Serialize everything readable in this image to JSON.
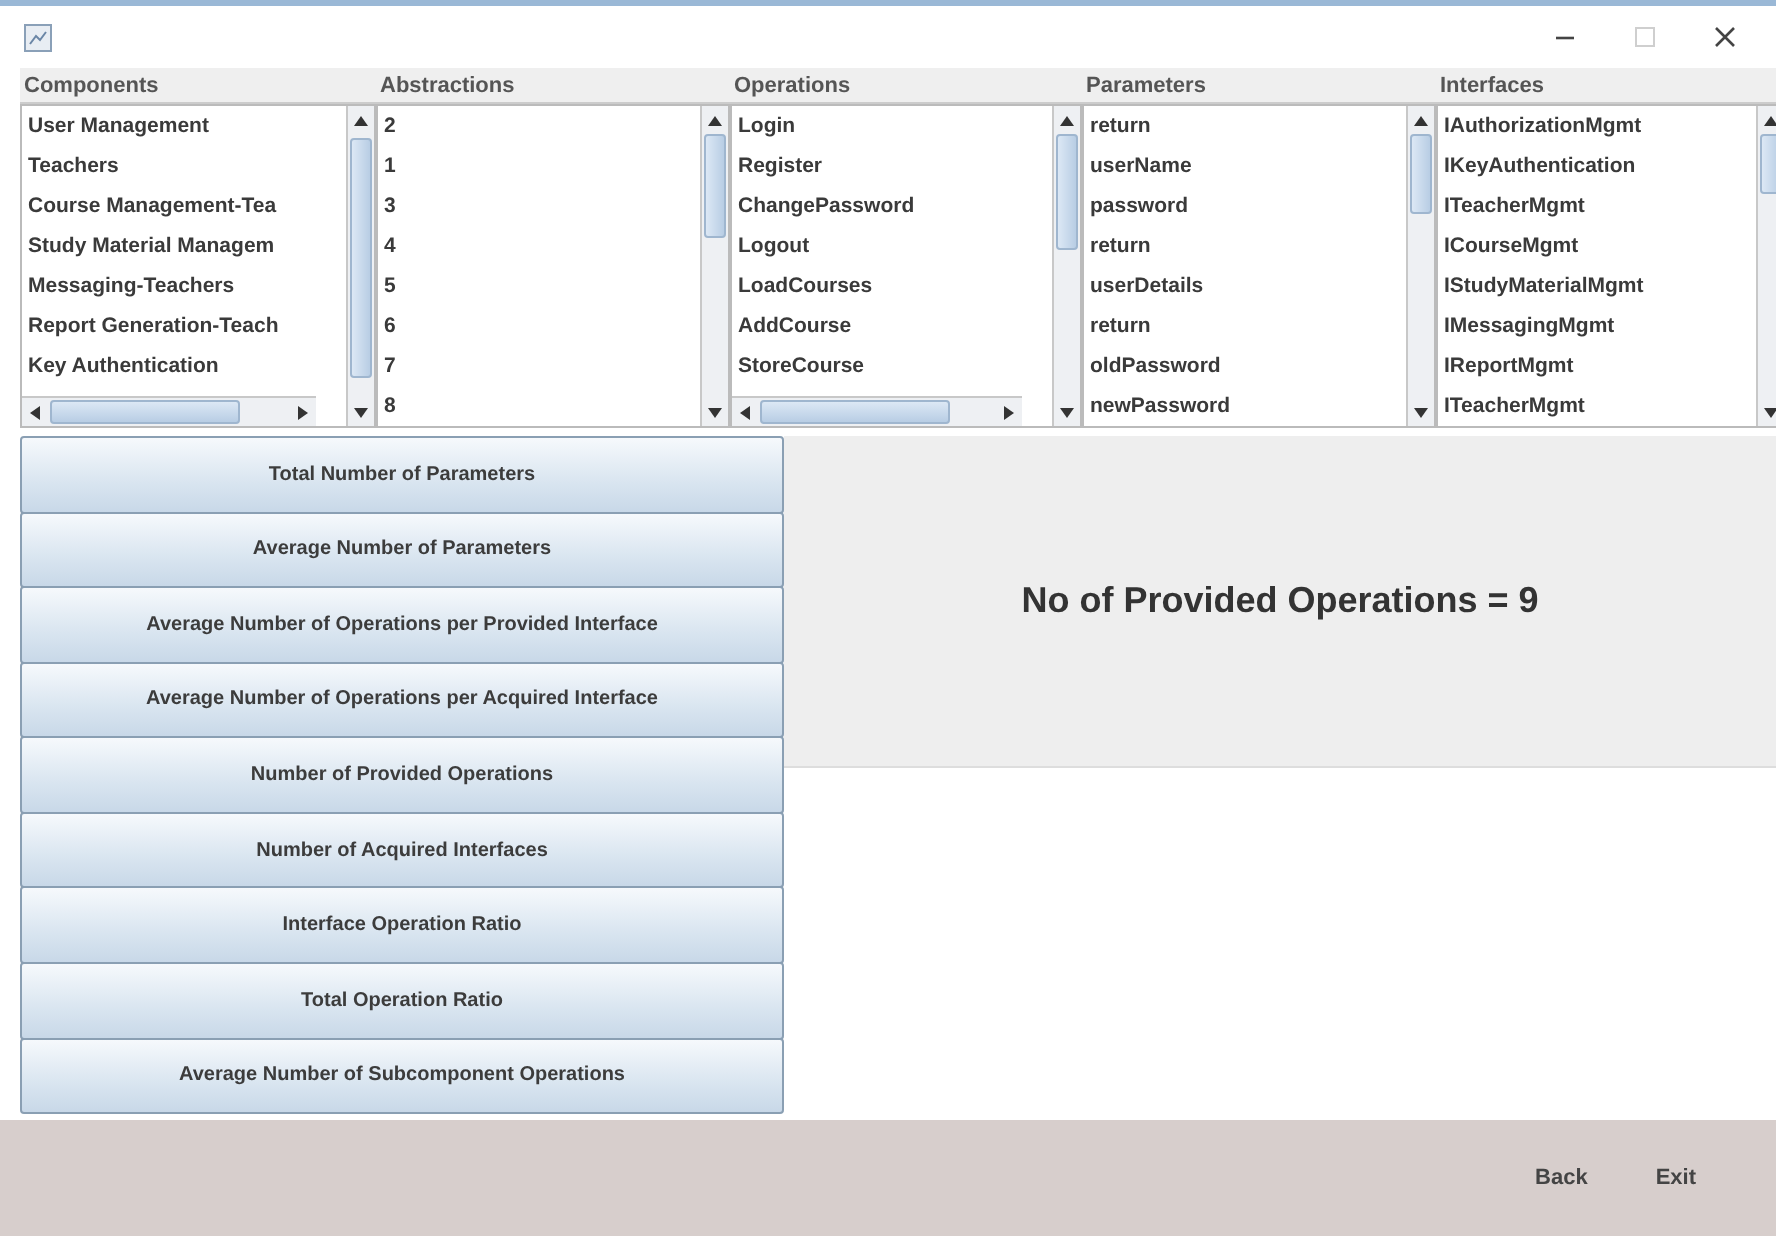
{
  "window": {
    "controls": [
      {
        "kind": "minimize",
        "disabled": false
      },
      {
        "kind": "maximize",
        "disabled": true
      },
      {
        "kind": "close",
        "disabled": false
      }
    ]
  },
  "lists": [
    {
      "title": "Components",
      "items": [
        "User Management",
        "Teachers",
        "Course Management-Tea",
        "Study Material Managem",
        "Messaging-Teachers",
        "Report Generation-Teach",
        "Key Authentication"
      ],
      "horizontal_scrollbar": true
    },
    {
      "title": "Abstractions",
      "items": [
        "2",
        "1",
        "3",
        "4",
        "5",
        "6",
        "7",
        "8"
      ],
      "horizontal_scrollbar": false
    },
    {
      "title": "Operations",
      "items": [
        "Login",
        "Register",
        "ChangePassword",
        "Logout",
        "LoadCourses",
        "AddCourse",
        "StoreCourse"
      ],
      "horizontal_scrollbar": true
    },
    {
      "title": "Parameters",
      "items": [
        "return",
        "userName",
        "password",
        "return",
        "userDetails",
        "return",
        "oldPassword",
        "newPassword"
      ],
      "horizontal_scrollbar": false
    },
    {
      "title": "Interfaces",
      "items": [
        "IAuthorizationMgmt",
        "IKeyAuthentication",
        "ITeacherMgmt",
        "ICourseMgmt",
        "IStudyMaterialMgmt",
        "IMessagingMgmt",
        "IReportMgmt",
        "ITeacherMgmt"
      ],
      "horizontal_scrollbar": false
    }
  ],
  "metric_buttons": [
    "Total Number of Parameters",
    "Average Number of Parameters",
    "Average Number of Operations per Provided Interface",
    "Average Number of Operations per Acquired Interface",
    "Number of Provided Operations",
    "Number of Acquired Interfaces",
    "Interface Operation Ratio",
    "Total Operation Ratio",
    "Average Number of Subcomponent Operations"
  ],
  "result": "No of Provided Operations = 9",
  "footer_buttons": [
    "Back",
    "Exit"
  ]
}
